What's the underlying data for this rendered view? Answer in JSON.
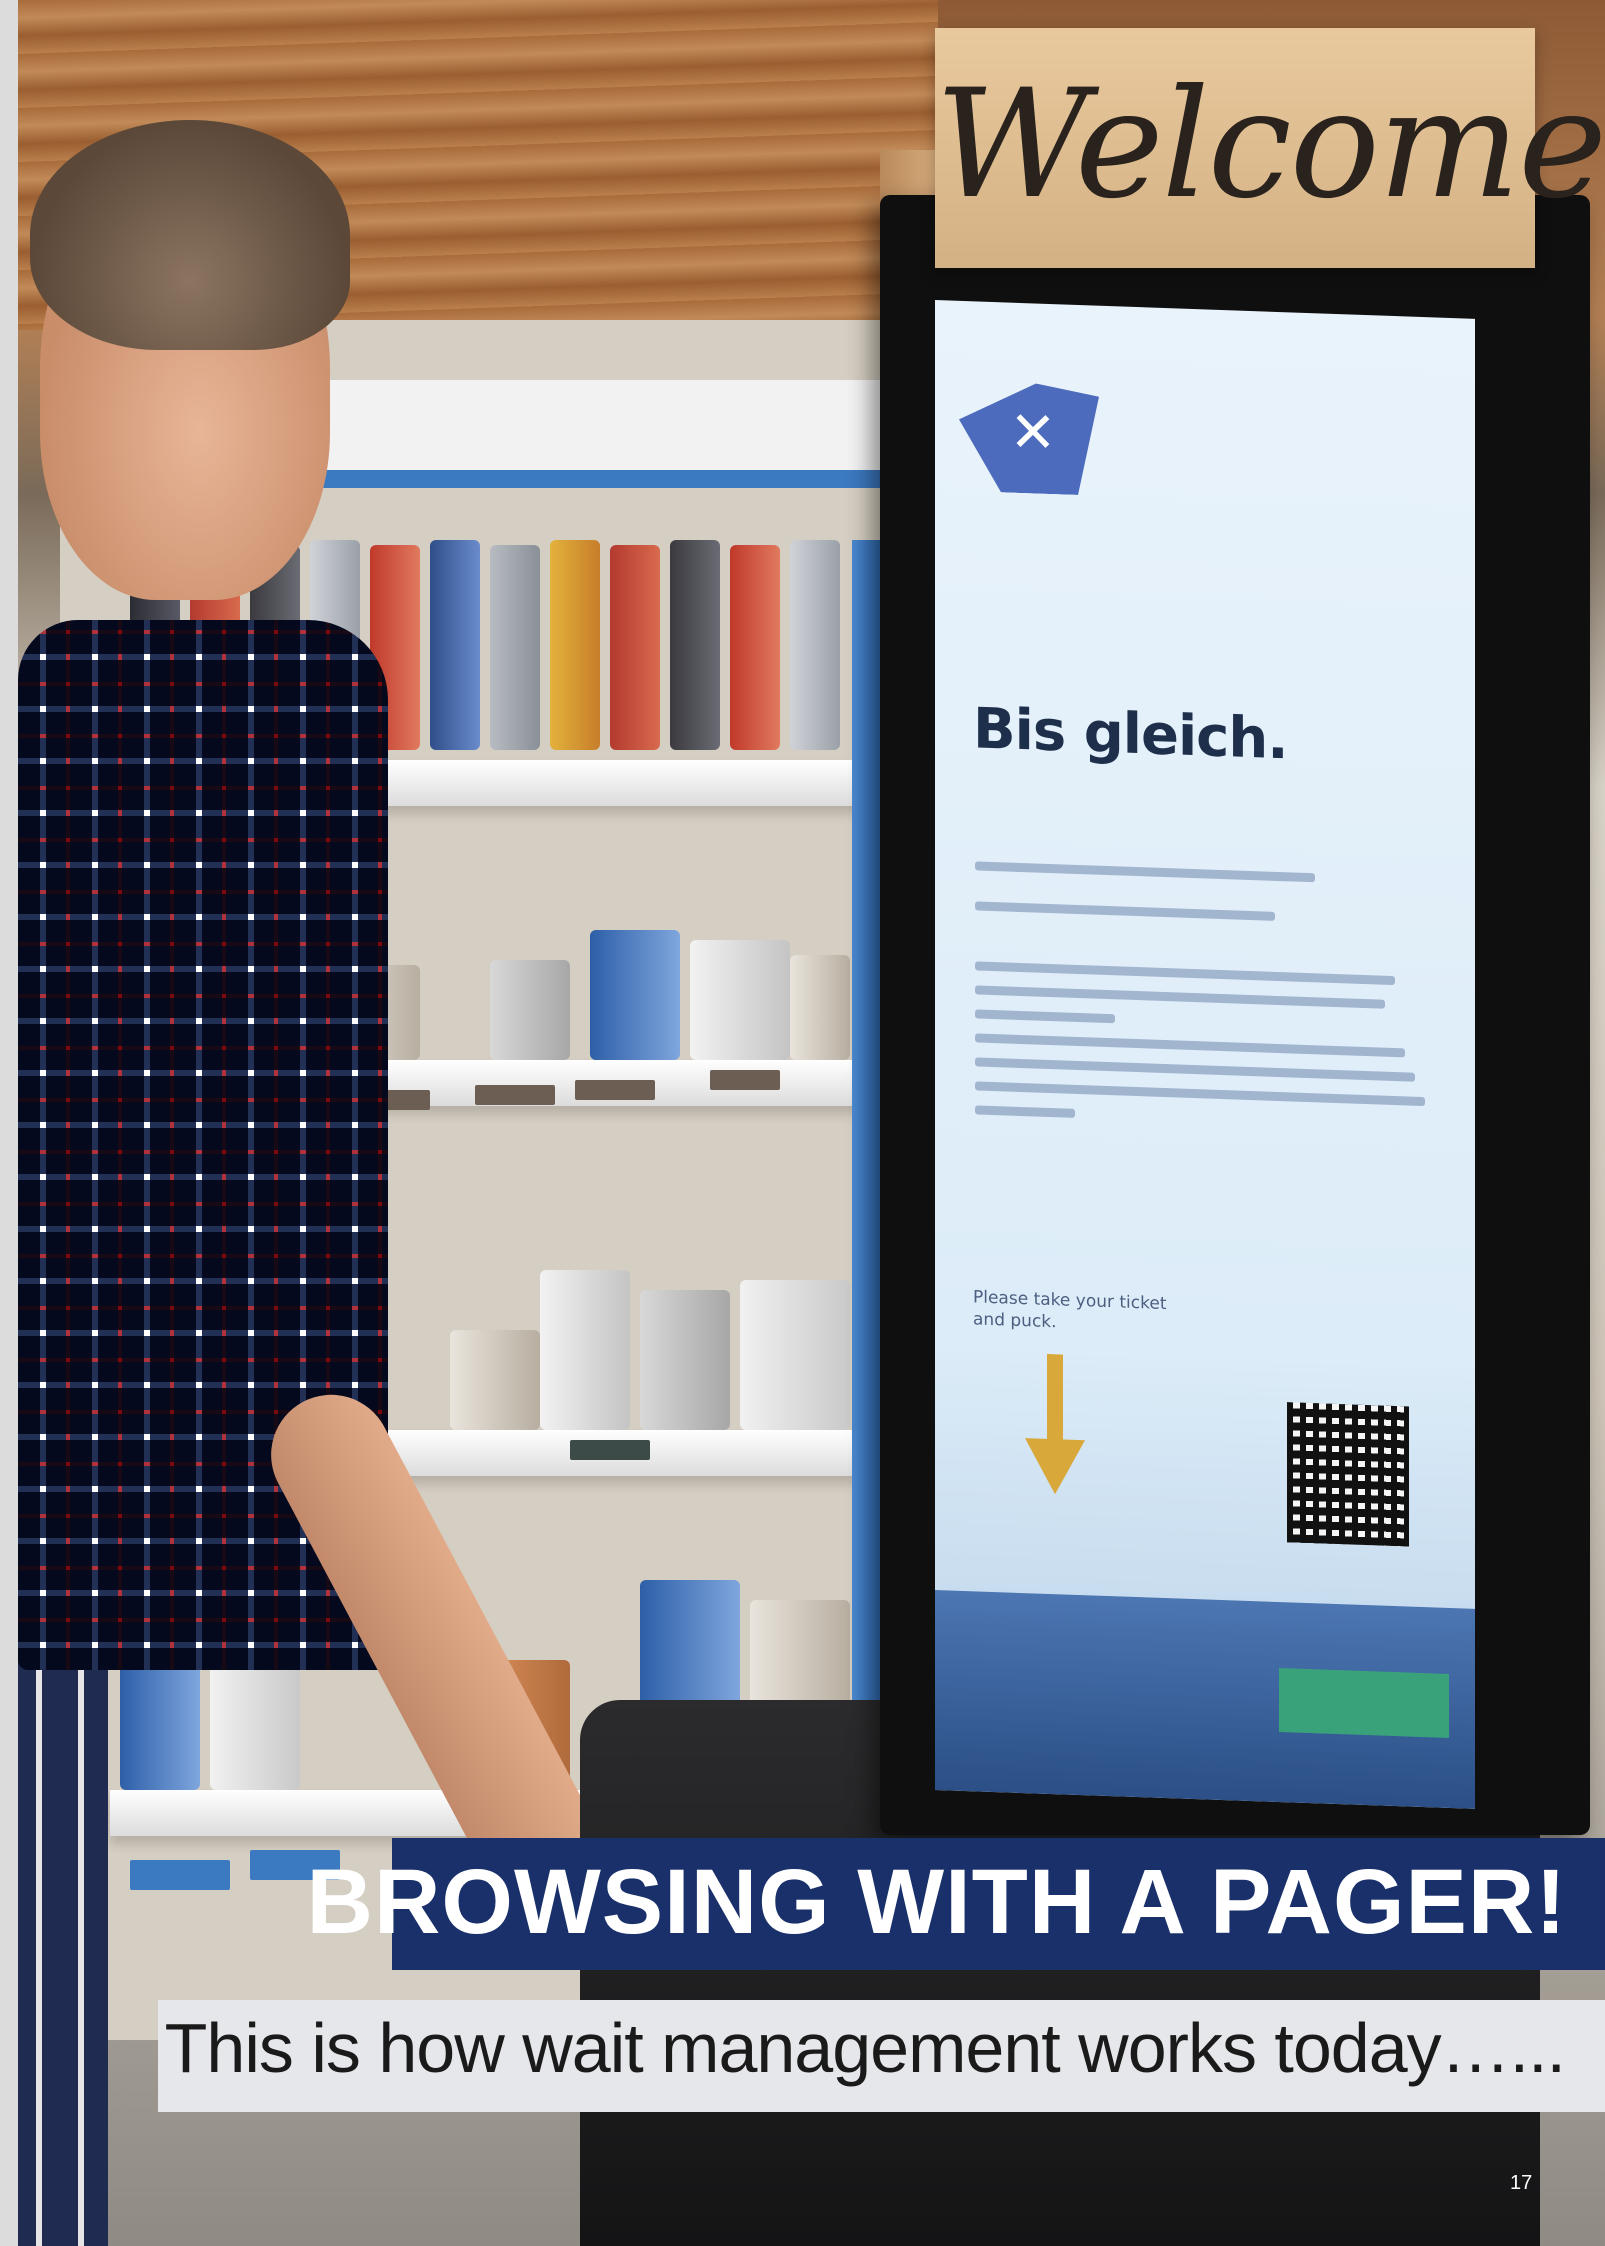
{
  "photo": {
    "sign_text": "Welcome",
    "kiosk_screen": {
      "logo_icon": "tools-icon",
      "heading": "Bis gleich.",
      "prompt": "Please take your ticket and puck.",
      "arrow_icon": "arrow-down-icon",
      "arrow_color": "#d9a83a",
      "qr_icon": "qr-code-icon",
      "button_color": "#3aa27b"
    }
  },
  "caption": {
    "title": "BROWSING WITH A PAGER!",
    "subtitle": "This is how wait management works today…...",
    "title_bg": "#19306b"
  },
  "page_number": "17"
}
